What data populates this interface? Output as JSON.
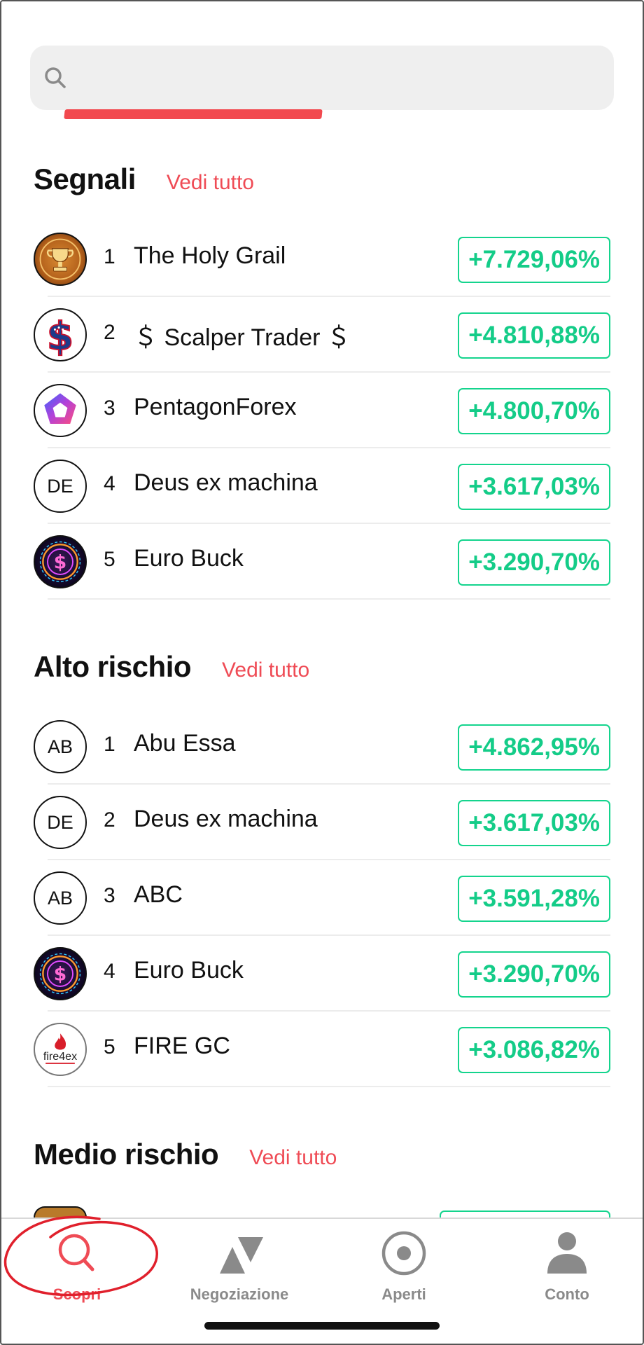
{
  "search": {
    "placeholder": ""
  },
  "sections": [
    {
      "title": "Segnali",
      "see_all": "Vedi tutto",
      "rows": [
        {
          "rank": "1",
          "name": "The Holy Grail",
          "pct": "+7.729,06%",
          "avatar": "trophy-icon"
        },
        {
          "rank": "2",
          "name": "＄ Scalper Trader ＄",
          "pct": "+4.810,88%",
          "avatar": "dollar-flag-icon"
        },
        {
          "rank": "3",
          "name": "PentagonForex",
          "pct": "+4.800,70%",
          "avatar": "pentagon-logo-icon"
        },
        {
          "rank": "4",
          "name": "Deus ex machina",
          "pct": "+3.617,03%",
          "avatar_text": "DE"
        },
        {
          "rank": "5",
          "name": "Euro Buck",
          "pct": "+3.290,70%",
          "avatar": "neon-coin-icon"
        }
      ]
    },
    {
      "title": "Alto rischio",
      "see_all": "Vedi tutto",
      "rows": [
        {
          "rank": "1",
          "name": "Abu Essa",
          "pct": "+4.862,95%",
          "avatar_text": "AB"
        },
        {
          "rank": "2",
          "name": "Deus ex machina",
          "pct": "+3.617,03%",
          "avatar_text": "DE"
        },
        {
          "rank": "3",
          "name": "ABC",
          "pct": "+3.591,28%",
          "avatar_text": "AB"
        },
        {
          "rank": "4",
          "name": "Euro Buck",
          "pct": "+3.290,70%",
          "avatar": "neon-coin-icon"
        },
        {
          "rank": "5",
          "name": "FIRE GC",
          "pct": "+3.086,82%",
          "avatar": "fire4ex-logo",
          "logo_text": "fire4ex"
        }
      ]
    },
    {
      "title": "Medio rischio",
      "see_all": "Vedi tutto"
    }
  ],
  "tabs": [
    {
      "label": "Scopri",
      "icon": "search-icon",
      "active": true
    },
    {
      "label": "Negoziazione",
      "icon": "up-down-triangles-icon",
      "active": false
    },
    {
      "label": "Aperti",
      "icon": "radio-circle-icon",
      "active": false
    },
    {
      "label": "Conto",
      "icon": "person-icon",
      "active": false
    }
  ],
  "colors": {
    "accent_red": "#ef4b55",
    "positive_green": "#14cc88",
    "tab_gray": "#8a8a8a"
  }
}
